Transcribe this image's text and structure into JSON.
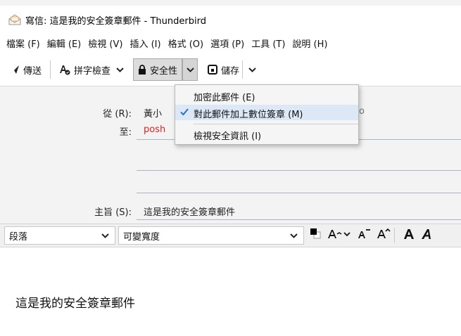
{
  "window": {
    "title": "寫信: 這是我的安全簽章郵件 - Thunderbird"
  },
  "menubar": {
    "items": [
      {
        "label": "檔案 (F)"
      },
      {
        "label": "編輯 (E)"
      },
      {
        "label": "檢視 (V)"
      },
      {
        "label": "插入 (I)"
      },
      {
        "label": "格式 (O)"
      },
      {
        "label": "選項 (P)"
      },
      {
        "label": "工具 (T)"
      },
      {
        "label": "說明 (H)"
      }
    ]
  },
  "toolbar": {
    "send_label": "傳送",
    "spell_label": "拼字檢查",
    "security_label": "安全性",
    "save_label": "儲存"
  },
  "headers": {
    "from_label": "從 (R):",
    "from_value": "黃小",
    "from_tail": "o",
    "to_label": "至:",
    "to_value": "posh",
    "subject_label": "主旨 (S):",
    "subject_value": "這是我的安全簽章郵件"
  },
  "security_menu": {
    "items": [
      {
        "label": "加密此郵件 (E)",
        "checked": false
      },
      {
        "label": "對此郵件加上數位簽章 (M)",
        "checked": true
      },
      {
        "label": "檢視安全資訊 (I)",
        "checked": false
      }
    ]
  },
  "format_bar": {
    "paragraph_value": "段落",
    "font_value": "可變寬度",
    "text_color": "#000000",
    "bg_color": "#ffffff"
  },
  "compose": {
    "body_text": "這是我的安全簽章郵件"
  },
  "colors": {
    "accent": "#3b6fc2",
    "recipient": "#e02020",
    "header_bg": "#f3f3f3"
  }
}
